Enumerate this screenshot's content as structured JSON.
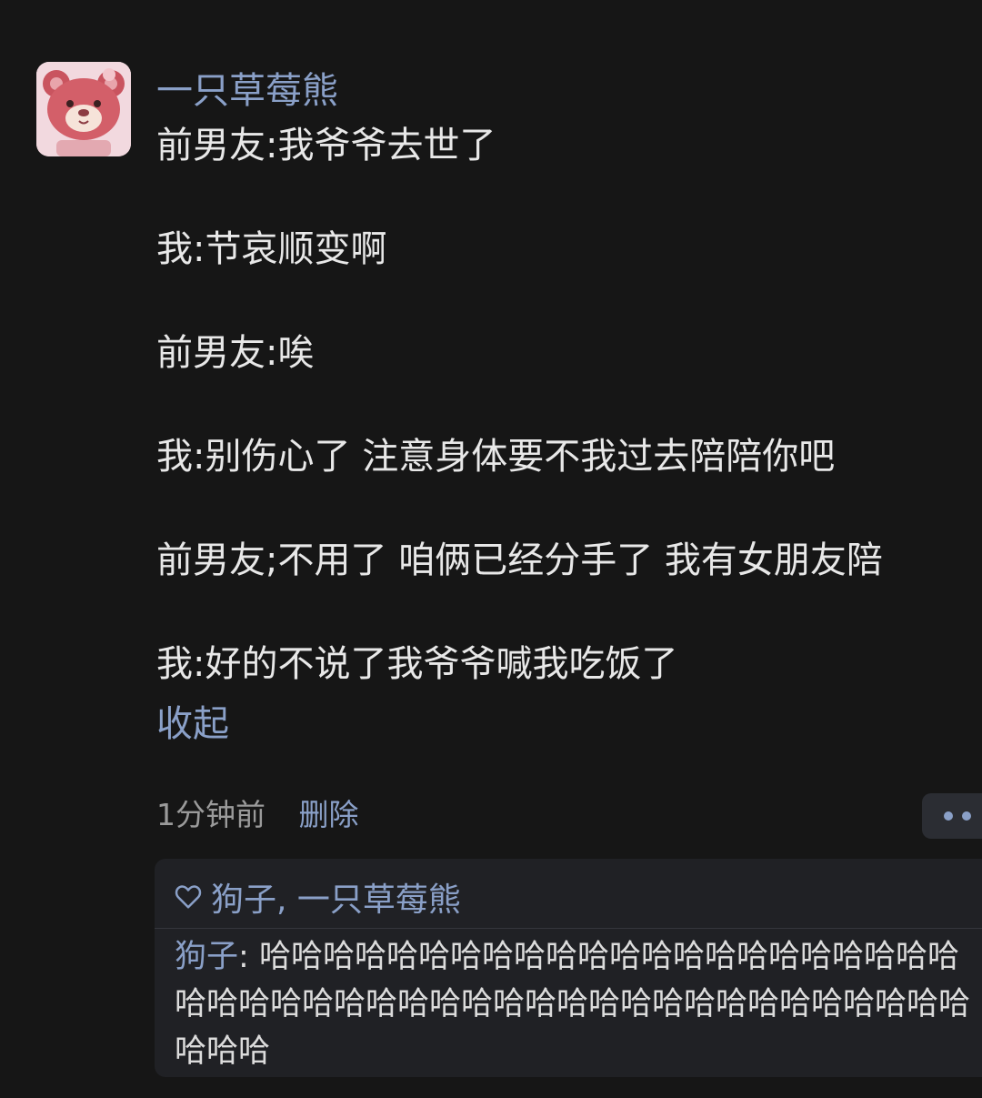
{
  "post": {
    "author": "一只草莓熊",
    "lines": [
      "前男友:我爷爷去世了",
      "我:节哀顺变啊",
      "前男友:唉",
      "我:别伤心了 注意身体要不我过去陪陪你吧",
      "前男友;不用了 咱俩已经分手了 我有女朋友陪",
      "我:好的不说了我爷爷喊我吃饭了"
    ],
    "collapse_label": "收起",
    "time": "1分钟前",
    "delete_label": "删除"
  },
  "interactions": {
    "likes": "狗子, 一只草莓熊",
    "reply": {
      "name": "狗子",
      "separator": ": ",
      "text": "哈哈哈哈哈哈哈哈哈哈哈哈哈哈哈哈哈哈哈哈哈哈哈哈哈哈哈哈哈哈哈哈哈哈哈哈哈哈哈哈哈哈哈哈哈哈哈哈哈哈"
    }
  },
  "icons": {
    "avatar": "strawberry-bear-avatar",
    "like": "heart-icon",
    "more": "more-dots-icon"
  },
  "colors": {
    "background": "#161616",
    "accent": "#8aa0c8",
    "text": "#e8e8e8",
    "muted": "#9a9a9a",
    "panel": "#202125"
  }
}
